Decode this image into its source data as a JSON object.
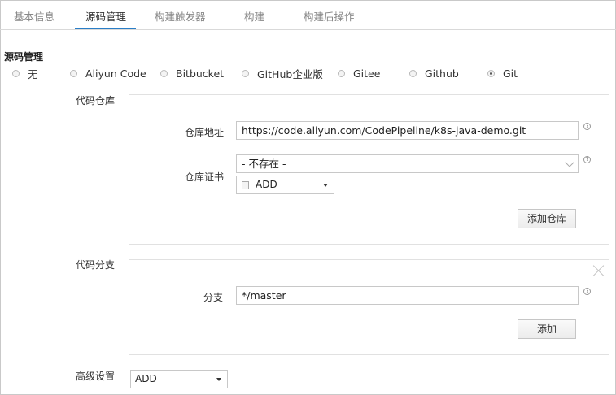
{
  "tabs": [
    {
      "label": "基本信息",
      "active": false
    },
    {
      "label": "源码管理",
      "active": true
    },
    {
      "label": "构建触发器",
      "active": false
    },
    {
      "label": "构建",
      "active": false
    },
    {
      "label": "构建后操作",
      "active": false
    }
  ],
  "source": {
    "title": "源码管理",
    "options": [
      "无",
      "Aliyun Code",
      "Bitbucket",
      "GitHub企业版",
      "Gitee",
      "Github",
      "Git"
    ],
    "selected": "Git"
  },
  "repo": {
    "section_label": "代码仓库",
    "url_label": "仓库地址",
    "url_value": "https://code.aliyun.com/CodePipeline/k8s-java-demo.git",
    "cert_label": "仓库证书",
    "cert_value": "- 不存在 -",
    "add_dropdown": "ADD",
    "add_repo_button": "添加仓库"
  },
  "branch": {
    "section_label": "代码分支",
    "branch_label": "分支",
    "branch_value": "*/master",
    "add_button": "添加"
  },
  "advanced": {
    "label": "高级设置",
    "dropdown": "ADD"
  },
  "help_glyph": "?",
  "colors": {
    "accent": "#2a7ec7"
  }
}
